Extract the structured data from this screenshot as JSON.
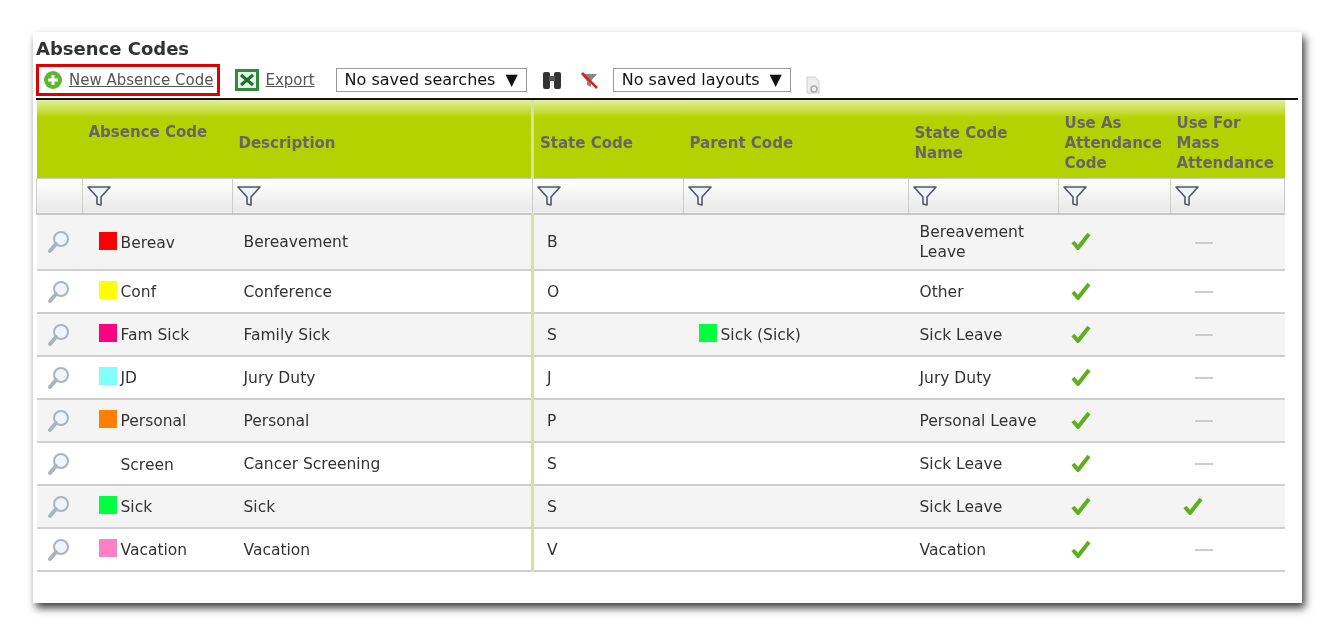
{
  "title": "Absence Codes",
  "toolbar": {
    "new_link": {
      "label": "New Absence Code",
      "highlighted": true
    },
    "export_link": {
      "label": "Export"
    },
    "search_select": {
      "value": "No saved searches",
      "arrow": "▼"
    },
    "layout_select": {
      "value": "No saved layouts",
      "arrow": "▼"
    }
  },
  "table": {
    "columns": [
      "Absence Code",
      "Description",
      "State Code",
      "Parent Code",
      "State Code Name",
      "Use As Attendance Code",
      "Use For Mass Attendance"
    ],
    "rows": [
      {
        "code": "Bereav",
        "color": "#ff0000",
        "description": "Bereavement",
        "state_code": "B",
        "state_code_name": "Bereavement Leave",
        "use_as_attendance": true,
        "mass_attendance": false
      },
      {
        "code": "Conf",
        "color": "#ffff00",
        "description": "Conference",
        "state_code": "O",
        "state_code_name": "Other",
        "use_as_attendance": true,
        "mass_attendance": false
      },
      {
        "code": "Fam Sick",
        "color": "#ff0080",
        "description": "Family Sick",
        "state_code": "S",
        "parent_code": {
          "label": "Sick (Sick)",
          "color": "#00ff40"
        },
        "state_code_name": "Sick Leave",
        "use_as_attendance": true,
        "mass_attendance": false
      },
      {
        "code": "JD",
        "color": "#80ffff",
        "description": "Jury Duty",
        "state_code": "J",
        "state_code_name": "Jury Duty",
        "use_as_attendance": true,
        "mass_attendance": false
      },
      {
        "code": "Personal",
        "color": "#ff8000",
        "description": "Personal",
        "state_code": "P",
        "state_code_name": "Personal Leave",
        "use_as_attendance": true,
        "mass_attendance": false
      },
      {
        "code": "Screen",
        "description": "Cancer Screening",
        "state_code": "S",
        "state_code_name": "Sick Leave",
        "use_as_attendance": true,
        "mass_attendance": false
      },
      {
        "code": "Sick",
        "color": "#00ff40",
        "description": "Sick",
        "state_code": "S",
        "state_code_name": "Sick Leave",
        "use_as_attendance": true,
        "mass_attendance": true
      },
      {
        "code": "Vacation",
        "color": "#ff80c0",
        "description": "Vacation",
        "state_code": "V",
        "state_code_name": "Vacation",
        "use_as_attendance": true,
        "mass_attendance": false
      }
    ]
  }
}
